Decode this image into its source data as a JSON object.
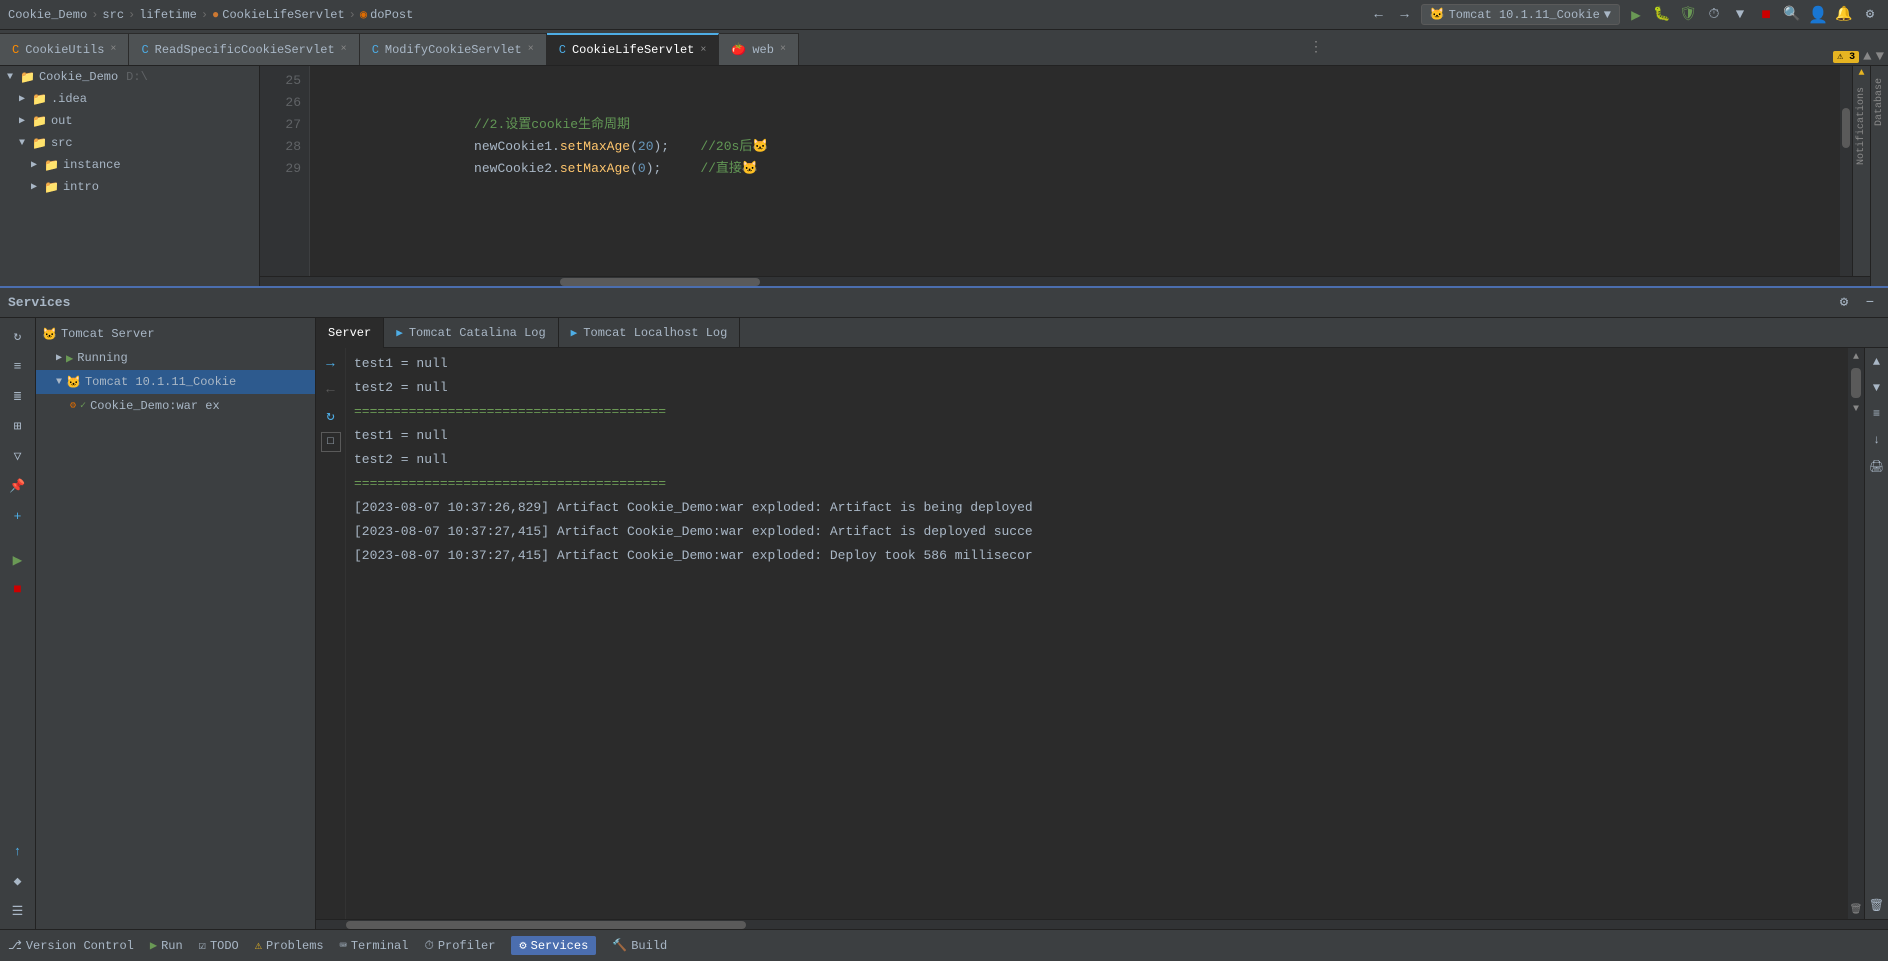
{
  "topbar": {
    "breadcrumbs": [
      "Cookie_Demo",
      "src",
      "lifetime",
      "CookieLifeServlet",
      "doPost"
    ],
    "run_config": "Tomcat 10.1.11_Cookie",
    "chevron": "▼"
  },
  "tabs": [
    {
      "label": "CookieUtils",
      "icon": "C",
      "icon_color": "blue",
      "active": false,
      "closeable": true
    },
    {
      "label": "ReadSpecificCookieServlet",
      "icon": "C",
      "icon_color": "blue",
      "active": false,
      "closeable": true
    },
    {
      "label": "ModifyCookieServlet",
      "icon": "C",
      "icon_color": "blue",
      "active": false,
      "closeable": true
    },
    {
      "label": "CookieLifeServlet",
      "icon": "C",
      "icon_color": "blue",
      "active": true,
      "closeable": true
    },
    {
      "label": "web",
      "icon": "xml",
      "icon_color": "orange",
      "active": false,
      "closeable": true
    }
  ],
  "editor": {
    "lines": [
      {
        "num": "25",
        "code": ""
      },
      {
        "num": "26",
        "code": "        //2.设置cookie生命周期"
      },
      {
        "num": "27",
        "code": "        newCookie1.setMaxAge(20);    //20s后🐱"
      },
      {
        "num": "28",
        "code": "        newCookie2.setMaxAge(0);     //直接🐱"
      },
      {
        "num": "29",
        "code": ""
      }
    ]
  },
  "project_tree": {
    "root": "Cookie_Demo",
    "root_path": "D:\\",
    "items": [
      {
        "label": ".idea",
        "indent": 1,
        "type": "dir",
        "expanded": false
      },
      {
        "label": "out",
        "indent": 1,
        "type": "dir",
        "expanded": false
      },
      {
        "label": "src",
        "indent": 1,
        "type": "dir",
        "expanded": true,
        "items": [
          {
            "label": "instance",
            "indent": 2,
            "type": "dir",
            "expanded": false
          },
          {
            "label": "intro",
            "indent": 2,
            "type": "dir",
            "expanded": false
          }
        ]
      }
    ]
  },
  "services_panel": {
    "title": "Services",
    "tabs": [
      "Server",
      "Tomcat Catalina Log",
      "Tomcat Localhost Log"
    ],
    "active_tab": "Server",
    "tree": [
      {
        "label": "Tomcat Server",
        "indent": 0,
        "type": "server"
      },
      {
        "label": "Running",
        "indent": 1,
        "type": "running"
      },
      {
        "label": "Tomcat 10.1.11_Cookie",
        "indent": 1,
        "type": "tomcat",
        "selected": true
      },
      {
        "label": "Cookie_Demo:war ex",
        "indent": 2,
        "type": "artifact"
      }
    ],
    "log_lines": [
      {
        "text": "test1 = null",
        "type": "normal"
      },
      {
        "text": "test2 = null",
        "type": "normal"
      },
      {
        "text": "========================================",
        "type": "equals"
      },
      {
        "text": "test1 = null",
        "type": "normal"
      },
      {
        "text": "test2 = null",
        "type": "normal"
      },
      {
        "text": "========================================",
        "type": "equals"
      },
      {
        "text": "[2023-08-07 10:37:26,829] Artifact Cookie_Demo:war exploded: Artifact is being deployed",
        "type": "artifact"
      },
      {
        "text": "[2023-08-07 10:37:27,415] Artifact Cookie_Demo:war exploded: Artifact is deployed succe",
        "type": "artifact"
      },
      {
        "text": "[2023-08-07 10:37:27,415] Artifact Cookie_Demo:war exploded: Deploy took 586 millisecor",
        "type": "artifact"
      }
    ]
  },
  "statusbar": {
    "items": [
      {
        "label": "Version Control",
        "icon": "branch"
      },
      {
        "label": "Run",
        "icon": "play"
      },
      {
        "label": "TODO",
        "icon": "check"
      },
      {
        "label": "Problems",
        "icon": "warn"
      },
      {
        "label": "Terminal",
        "icon": "terminal"
      },
      {
        "label": "Profiler",
        "icon": "profiler"
      },
      {
        "label": "Services",
        "icon": "services",
        "active": true
      },
      {
        "label": "Build",
        "icon": "build"
      }
    ]
  },
  "warnings": {
    "count": 3,
    "label": "⚠ 3"
  },
  "icons": {
    "expand": "▶",
    "collapse": "▼",
    "folder": "📁",
    "close": "×",
    "refresh": "↻",
    "up": "▲",
    "down": "▼",
    "arrow_right": "→",
    "arrow_left": "←",
    "search": "🔍",
    "settings": "⚙",
    "maximize": "⬜",
    "minimize": "−",
    "play": "▶",
    "stop": "■"
  }
}
